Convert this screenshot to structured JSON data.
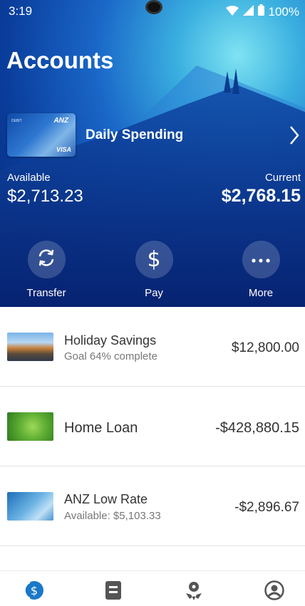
{
  "status_bar": {
    "time": "3:19",
    "battery": "100%"
  },
  "page": {
    "title": "Accounts"
  },
  "primary_account": {
    "name": "Daily Spending",
    "card": {
      "brand": "ANZ",
      "type": "DEBIT",
      "network": "VISA"
    },
    "available_label": "Available",
    "available_value": "$2,713.23",
    "current_label": "Current",
    "current_value": "$2,768.15"
  },
  "actions": [
    {
      "label": "Transfer",
      "icon": "refresh-icon"
    },
    {
      "label": "Pay",
      "icon": "dollar-icon"
    },
    {
      "label": "More",
      "icon": "more-icon"
    }
  ],
  "accounts": [
    {
      "title": "Holiday Savings",
      "subtitle": "Goal 64% complete",
      "amount": "$12,800.00",
      "thumb": "beach-image"
    },
    {
      "title": "Home Loan",
      "subtitle": "",
      "amount": "-$428,880.15",
      "thumb": "leaf-image"
    },
    {
      "title": "ANZ Low Rate",
      "subtitle": "Available: $5,103.33",
      "amount": "-$2,896.67",
      "thumb": "card-image"
    }
  ],
  "bottom_nav": [
    {
      "icon": "accounts-icon",
      "active": true
    },
    {
      "icon": "statements-icon",
      "active": false
    },
    {
      "icon": "rewards-icon",
      "active": false
    },
    {
      "icon": "profile-icon",
      "active": false
    }
  ],
  "colors": {
    "accent": "#1a78c8",
    "nav_inactive": "#555555"
  }
}
